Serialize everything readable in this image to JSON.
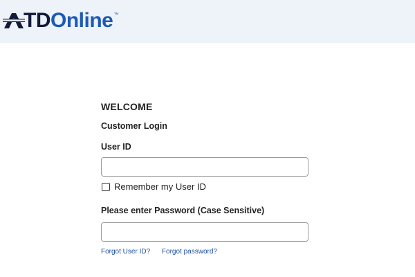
{
  "header": {
    "logo": {
      "text_td": "TD",
      "text_online": "Online",
      "trademark": "™"
    }
  },
  "form": {
    "welcome": "WELCOME",
    "subtitle": "Customer Login",
    "userid_label": "User ID",
    "userid_value": "",
    "remember_label": "Remember my User ID",
    "remember_checked": false,
    "password_label": "Please enter Password (Case Sensitive)",
    "password_value": "",
    "forgot_userid": "Forgot User ID?",
    "forgot_password": "Forgot password?"
  },
  "colors": {
    "header_bg": "#eef3fa",
    "brand_dark": "#131a3a",
    "brand_blue": "#1d5ab5",
    "link": "#1d4f9c"
  }
}
